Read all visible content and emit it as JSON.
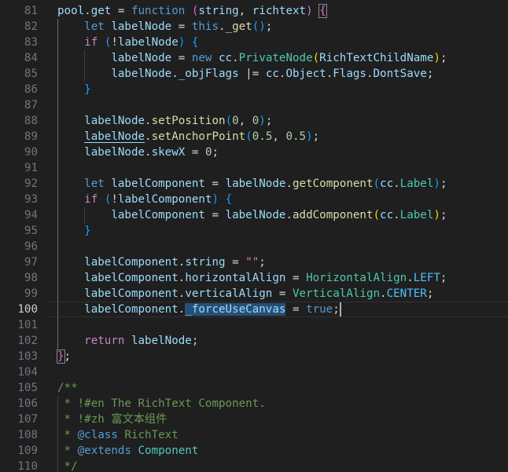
{
  "editor": {
    "active_line": "100",
    "theme_colors": {
      "background": "#1f1f1f",
      "keyword": "#569cd6",
      "control": "#c586c0",
      "variable": "#9cdcfe",
      "function": "#dcdcaa",
      "class": "#4ec9b0",
      "constant": "#4fc1ff",
      "number": "#b5cea8",
      "string": "#ce9178",
      "comment": "#6a9955",
      "bracket_level1": "#ffd700",
      "bracket_level2": "#da70d6",
      "bracket_level3": "#179fff",
      "selection": "#264f78"
    },
    "lines": [
      {
        "num": "81",
        "tokens": [
          {
            "t": "pool",
            "c": "var"
          },
          {
            "t": ".",
            "c": "op"
          },
          {
            "t": "get",
            "c": "var"
          },
          {
            "t": " = ",
            "c": "op"
          },
          {
            "t": "function",
            "c": "kw"
          },
          {
            "t": " ",
            "c": "op"
          },
          {
            "t": "(",
            "c": "br2"
          },
          {
            "t": "string",
            "c": "var"
          },
          {
            "t": ", ",
            "c": "op"
          },
          {
            "t": "richtext",
            "c": "var"
          },
          {
            "t": ")",
            "c": "br2"
          },
          {
            "t": " ",
            "c": "op"
          },
          {
            "t": "{",
            "c": "br2",
            "match": true
          }
        ]
      },
      {
        "num": "82",
        "tokens": [
          {
            "t": "    ",
            "c": "op"
          },
          {
            "t": "let",
            "c": "kw"
          },
          {
            "t": " ",
            "c": "op"
          },
          {
            "t": "labelNode",
            "c": "var"
          },
          {
            "t": " = ",
            "c": "op"
          },
          {
            "t": "this",
            "c": "kw"
          },
          {
            "t": ".",
            "c": "op"
          },
          {
            "t": "_get",
            "c": "fn"
          },
          {
            "t": "(",
            "c": "br3"
          },
          {
            "t": ")",
            "c": "br3"
          },
          {
            "t": ";",
            "c": "op"
          }
        ]
      },
      {
        "num": "83",
        "tokens": [
          {
            "t": "    ",
            "c": "op"
          },
          {
            "t": "if",
            "c": "ctrl"
          },
          {
            "t": " ",
            "c": "op"
          },
          {
            "t": "(",
            "c": "br3"
          },
          {
            "t": "!",
            "c": "op"
          },
          {
            "t": "labelNode",
            "c": "var"
          },
          {
            "t": ")",
            "c": "br3"
          },
          {
            "t": " ",
            "c": "op"
          },
          {
            "t": "{",
            "c": "br3"
          }
        ]
      },
      {
        "num": "84",
        "tokens": [
          {
            "t": "        ",
            "c": "op"
          },
          {
            "t": "labelNode",
            "c": "var"
          },
          {
            "t": " = ",
            "c": "op"
          },
          {
            "t": "new",
            "c": "kw"
          },
          {
            "t": " ",
            "c": "op"
          },
          {
            "t": "cc",
            "c": "var"
          },
          {
            "t": ".",
            "c": "op"
          },
          {
            "t": "PrivateNode",
            "c": "cls"
          },
          {
            "t": "(",
            "c": "br1"
          },
          {
            "t": "RichTextChildName",
            "c": "var"
          },
          {
            "t": ")",
            "c": "br1"
          },
          {
            "t": ";",
            "c": "op"
          }
        ]
      },
      {
        "num": "85",
        "tokens": [
          {
            "t": "        ",
            "c": "op"
          },
          {
            "t": "labelNode",
            "c": "var"
          },
          {
            "t": ".",
            "c": "op"
          },
          {
            "t": "_objFlags",
            "c": "var"
          },
          {
            "t": " |= ",
            "c": "op"
          },
          {
            "t": "cc",
            "c": "var"
          },
          {
            "t": ".",
            "c": "op"
          },
          {
            "t": "Object",
            "c": "var"
          },
          {
            "t": ".",
            "c": "op"
          },
          {
            "t": "Flags",
            "c": "var"
          },
          {
            "t": ".",
            "c": "op"
          },
          {
            "t": "DontSave",
            "c": "var"
          },
          {
            "t": ";",
            "c": "op"
          }
        ]
      },
      {
        "num": "86",
        "tokens": [
          {
            "t": "    ",
            "c": "op"
          },
          {
            "t": "}",
            "c": "br3"
          }
        ]
      },
      {
        "num": "87",
        "tokens": []
      },
      {
        "num": "88",
        "tokens": [
          {
            "t": "    ",
            "c": "op"
          },
          {
            "t": "labelNode",
            "c": "var"
          },
          {
            "t": ".",
            "c": "op"
          },
          {
            "t": "setPosition",
            "c": "fn"
          },
          {
            "t": "(",
            "c": "br3"
          },
          {
            "t": "0",
            "c": "num"
          },
          {
            "t": ", ",
            "c": "op"
          },
          {
            "t": "0",
            "c": "num"
          },
          {
            "t": ")",
            "c": "br3"
          },
          {
            "t": ";",
            "c": "op"
          }
        ]
      },
      {
        "num": "89",
        "tokens": [
          {
            "t": "    ",
            "c": "op"
          },
          {
            "t": "labelNode",
            "c": "var",
            "u": "solid"
          },
          {
            "t": ".",
            "c": "op"
          },
          {
            "t": "setAnchorPoint",
            "c": "fn"
          },
          {
            "t": "(",
            "c": "br3"
          },
          {
            "t": "0.5",
            "c": "num"
          },
          {
            "t": ", ",
            "c": "op"
          },
          {
            "t": "0.5",
            "c": "num"
          },
          {
            "t": ")",
            "c": "br3"
          },
          {
            "t": ";",
            "c": "op"
          }
        ]
      },
      {
        "num": "90",
        "tokens": [
          {
            "t": "    ",
            "c": "op"
          },
          {
            "t": "labelNode",
            "c": "var"
          },
          {
            "t": ".",
            "c": "op"
          },
          {
            "t": "skewX",
            "c": "var"
          },
          {
            "t": " = ",
            "c": "op"
          },
          {
            "t": "0",
            "c": "num"
          },
          {
            "t": ";",
            "c": "op"
          }
        ]
      },
      {
        "num": "91",
        "tokens": []
      },
      {
        "num": "92",
        "tokens": [
          {
            "t": "    ",
            "c": "op"
          },
          {
            "t": "let",
            "c": "kw"
          },
          {
            "t": " ",
            "c": "op"
          },
          {
            "t": "labelComponent",
            "c": "var"
          },
          {
            "t": " = ",
            "c": "op"
          },
          {
            "t": "labelNode",
            "c": "var"
          },
          {
            "t": ".",
            "c": "op"
          },
          {
            "t": "getComponent",
            "c": "fn"
          },
          {
            "t": "(",
            "c": "br3"
          },
          {
            "t": "cc",
            "c": "var"
          },
          {
            "t": ".",
            "c": "op"
          },
          {
            "t": "Label",
            "c": "cls"
          },
          {
            "t": ")",
            "c": "br3"
          },
          {
            "t": ";",
            "c": "op"
          }
        ]
      },
      {
        "num": "93",
        "tokens": [
          {
            "t": "    ",
            "c": "op"
          },
          {
            "t": "if",
            "c": "ctrl"
          },
          {
            "t": " ",
            "c": "op"
          },
          {
            "t": "(",
            "c": "br3"
          },
          {
            "t": "!",
            "c": "op"
          },
          {
            "t": "labelComponent",
            "c": "var"
          },
          {
            "t": ")",
            "c": "br3"
          },
          {
            "t": " ",
            "c": "op"
          },
          {
            "t": "{",
            "c": "br3"
          }
        ]
      },
      {
        "num": "94",
        "tokens": [
          {
            "t": "        ",
            "c": "op"
          },
          {
            "t": "labelComponent",
            "c": "var"
          },
          {
            "t": " = ",
            "c": "op"
          },
          {
            "t": "labelNode",
            "c": "var"
          },
          {
            "t": ".",
            "c": "op"
          },
          {
            "t": "addComponent",
            "c": "fn"
          },
          {
            "t": "(",
            "c": "br1"
          },
          {
            "t": "cc",
            "c": "var"
          },
          {
            "t": ".",
            "c": "op"
          },
          {
            "t": "Label",
            "c": "cls"
          },
          {
            "t": ")",
            "c": "br1"
          },
          {
            "t": ";",
            "c": "op"
          }
        ]
      },
      {
        "num": "95",
        "tokens": [
          {
            "t": "    ",
            "c": "op"
          },
          {
            "t": "}",
            "c": "br3"
          }
        ]
      },
      {
        "num": "96",
        "tokens": []
      },
      {
        "num": "97",
        "tokens": [
          {
            "t": "    ",
            "c": "op"
          },
          {
            "t": "labelComponent",
            "c": "var"
          },
          {
            "t": ".",
            "c": "op"
          },
          {
            "t": "string",
            "c": "var"
          },
          {
            "t": " = ",
            "c": "op"
          },
          {
            "t": "\"\"",
            "c": "str"
          },
          {
            "t": ";",
            "c": "op"
          }
        ]
      },
      {
        "num": "98",
        "tokens": [
          {
            "t": "    ",
            "c": "op"
          },
          {
            "t": "labelComponent",
            "c": "var"
          },
          {
            "t": ".",
            "c": "op"
          },
          {
            "t": "horizontalAlign",
            "c": "var"
          },
          {
            "t": " = ",
            "c": "op"
          },
          {
            "t": "HorizontalAlign",
            "c": "cls"
          },
          {
            "t": ".",
            "c": "op"
          },
          {
            "t": "LEFT",
            "c": "const"
          },
          {
            "t": ";",
            "c": "op"
          }
        ]
      },
      {
        "num": "99",
        "tokens": [
          {
            "t": "    ",
            "c": "op"
          },
          {
            "t": "labelComponent",
            "c": "var"
          },
          {
            "t": ".",
            "c": "op"
          },
          {
            "t": "verticalAlign",
            "c": "var"
          },
          {
            "t": " = ",
            "c": "op"
          },
          {
            "t": "VerticalAlign",
            "c": "cls"
          },
          {
            "t": ".",
            "c": "op"
          },
          {
            "t": "CENTER",
            "c": "const"
          },
          {
            "t": ";",
            "c": "op"
          }
        ]
      },
      {
        "num": "100",
        "tokens": [
          {
            "t": "    ",
            "c": "op"
          },
          {
            "t": "labelComponent",
            "c": "var"
          },
          {
            "t": ".",
            "c": "op"
          },
          {
            "t": "_forceUseCanvas",
            "c": "var",
            "sel": true
          },
          {
            "t": " = ",
            "c": "op"
          },
          {
            "t": "true",
            "c": "kw"
          },
          {
            "t": ";",
            "c": "op"
          }
        ]
      },
      {
        "num": "101",
        "tokens": []
      },
      {
        "num": "102",
        "tokens": [
          {
            "t": "    ",
            "c": "op"
          },
          {
            "t": "return",
            "c": "ctrl"
          },
          {
            "t": " ",
            "c": "op"
          },
          {
            "t": "labelNode",
            "c": "var"
          },
          {
            "t": ";",
            "c": "op"
          }
        ]
      },
      {
        "num": "103",
        "tokens": [
          {
            "t": "}",
            "c": "br2",
            "match": true
          },
          {
            "t": ";",
            "c": "op"
          }
        ]
      },
      {
        "num": "104",
        "tokens": []
      },
      {
        "num": "105",
        "tokens": [
          {
            "t": "/**",
            "c": "cmt"
          }
        ]
      },
      {
        "num": "106",
        "tokens": [
          {
            "t": " * !#en The RichText Component.",
            "c": "cmt"
          }
        ]
      },
      {
        "num": "107",
        "tokens": [
          {
            "t": " * !#zh 富文本组件",
            "c": "cmt"
          }
        ]
      },
      {
        "num": "108",
        "tokens": [
          {
            "t": " * ",
            "c": "cmt"
          },
          {
            "t": "@class",
            "c": "kw"
          },
          {
            "t": " ",
            "c": "cmt"
          },
          {
            "t": "RichText",
            "c": "cmt"
          }
        ]
      },
      {
        "num": "109",
        "tokens": [
          {
            "t": " * ",
            "c": "cmt"
          },
          {
            "t": "@extends",
            "c": "kw"
          },
          {
            "t": " ",
            "c": "cmt"
          },
          {
            "t": "Component",
            "c": "cls"
          }
        ]
      },
      {
        "num": "110",
        "tokens": [
          {
            "t": " */",
            "c": "cmt"
          }
        ]
      }
    ]
  }
}
